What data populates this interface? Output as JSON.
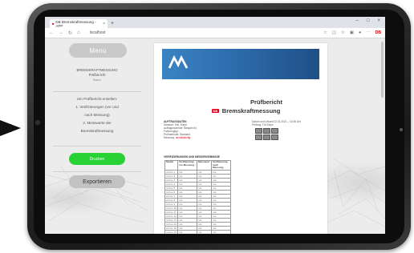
{
  "browser": {
    "tab_title": "DB Bremskraftmessung - APP",
    "new_tab": "+",
    "window_controls": [
      "–",
      "□",
      "×"
    ],
    "nav": [
      "←",
      "→",
      "↻",
      "⌂"
    ],
    "url": "localhost",
    "toolbar_icons": [
      "star-icon",
      "reading-icon",
      "favorites-icon",
      "collections-icon",
      "profile-icon",
      "more-icon"
    ],
    "extension_badge": "DB"
  },
  "sidebar": {
    "menu_label": "Menü",
    "title_line1": "BREMSKRAFTMESSUNG",
    "title_line2": "Prüfbericht",
    "title_line3": "Status",
    "steps": [
      "Um Prüfbericht erstellen:",
      "1. Verifizierungen (vor und",
      "nach Messung)",
      "2. Messwerte der",
      "Bremskraftmessung"
    ],
    "print_label": "Drucken",
    "export_label": "Exportieren"
  },
  "document": {
    "report_title": "Prüfbericht",
    "db_badge": "DB",
    "report_subtitle": "Bremskraftmessung",
    "meta_left": {
      "heading": "AUFTRAGSDATEN",
      "lines": [
        "Standort: Kiel, Kiepe",
        "Auftragsnummer: Beispiel #4",
        "Fahrzeugtyp:",
        "Prüfmethode: Standard"
      ],
      "status_label": "Messung:",
      "status_value": "unvollständig"
    },
    "meta_right": {
      "line1": "Datum und Uhrzeit 22.01.2021 – 10:45 Uhr",
      "line2": "Prüfung: Tür Kiepe"
    },
    "table_heading": "VERIFIZIERUNGEN UND MESSERGEBNISSE",
    "table_headers": [
      "Modul",
      "Verifizierung vor Messung",
      "Messwert",
      "Verifizierung nach Messung"
    ],
    "table_rows": [
      [
        "Achse 1",
        "n/a",
        "n/a",
        "n/a"
      ],
      [
        "Achse 2",
        "n/a",
        "n/a",
        "n/a"
      ],
      [
        "Achse 3",
        "n/a",
        "n/a",
        "n/a"
      ],
      [
        "Achse 4",
        "n/a",
        "n/a",
        "n/a"
      ],
      [
        "Achse 5",
        "n/a",
        "n/a",
        "n/a"
      ],
      [
        "Achse 6",
        "n/a",
        "n/a",
        "n/a"
      ],
      [
        "Achse 7",
        "n/a",
        "n/a",
        "n/a"
      ],
      [
        "Achse 8",
        "n/a",
        "n/a",
        "n/a"
      ],
      [
        "Achse 9",
        "n/a",
        "n/a",
        "n/a"
      ],
      [
        "Achse 10",
        "n/a",
        "n/a",
        "n/a"
      ],
      [
        "Achse 11",
        "n/a",
        "n/a",
        "n/a"
      ],
      [
        "Achse 12",
        "n/a",
        "n/a",
        "n/a"
      ],
      [
        "Achse 13",
        "n/a",
        "n/a",
        "n/a"
      ],
      [
        "Achse 14",
        "n/a",
        "n/a",
        "n/a"
      ],
      [
        "Achse 15",
        "n/a",
        "n/a",
        "n/a"
      ],
      [
        "Achse 16",
        "n/a",
        "n/a",
        "n/a"
      ],
      [
        "Achse 17",
        "n/a",
        "n/a",
        "n/a"
      ],
      [
        "Achse 18",
        "n/a",
        "n/a",
        "n/a"
      ],
      [
        "Achse 19",
        "n/a",
        "n/a",
        "n/a"
      ],
      [
        "Achse 20",
        "n/a",
        "n/a",
        "n/a"
      ],
      [
        "Achse 21",
        "n/a",
        "n/a",
        "n/a"
      ]
    ]
  },
  "colors": {
    "print_button": "#28d234",
    "db_red": "#e2001a",
    "banner_blue": "#2f6fb0"
  }
}
